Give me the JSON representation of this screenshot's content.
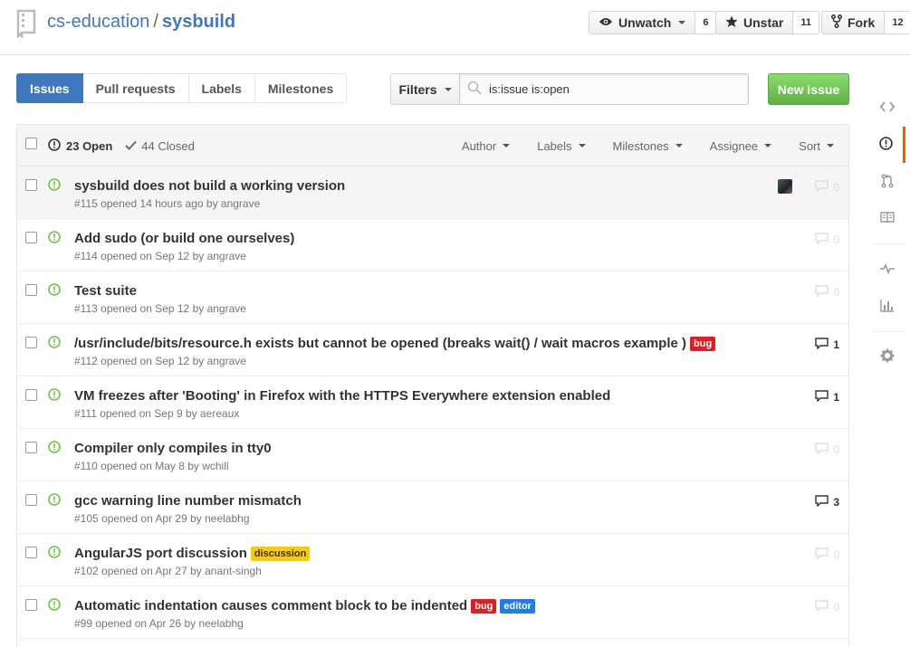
{
  "repo": {
    "owner": "cs-education",
    "separator": "/",
    "name": "sysbuild"
  },
  "actions": {
    "watch": {
      "label": "Unwatch",
      "count": "6"
    },
    "star": {
      "label": "Unstar",
      "count": "11"
    },
    "fork": {
      "label": "Fork",
      "count": "12"
    }
  },
  "subnav": {
    "issues": "Issues",
    "pulls": "Pull requests",
    "labels": "Labels",
    "milestones": "Milestones"
  },
  "filters": {
    "label": "Filters",
    "query": "is:issue is:open"
  },
  "new_issue": "New issue",
  "table_header": {
    "open": "23 Open",
    "closed": "44 Closed",
    "author": "Author",
    "labels": "Labels",
    "milestones": "Milestones",
    "assignee": "Assignee",
    "sort": "Sort"
  },
  "issues": [
    {
      "title": "sysbuild does not build a working version",
      "meta": "#115 opened 14 hours ago by angrave",
      "comments": "0"
    },
    {
      "title": "Add sudo (or build one ourselves)",
      "meta": "#114 opened on Sep 12 by angrave",
      "comments": "0"
    },
    {
      "title": "Test suite",
      "meta": "#113 opened on Sep 12 by angrave",
      "comments": "0"
    },
    {
      "title": "/usr/include/bits/resource.h exists but cannot be opened (breaks wait() / wait macros example )",
      "meta": "#112 opened on Sep 12 by angrave",
      "comments": "1",
      "label1": "bug"
    },
    {
      "title": "VM freezes after 'Booting' in Firefox with the HTTPS Everywhere extension enabled",
      "meta": "#111 opened on Sep 9 by aereaux",
      "comments": "1"
    },
    {
      "title": "Compiler only compiles in tty0",
      "meta": "#110 opened on May 8 by wchill",
      "comments": "0"
    },
    {
      "title": "gcc warning line number mismatch",
      "meta": "#105 opened on Apr 29 by neelabhg",
      "comments": "3"
    },
    {
      "title": "AngularJS port discussion",
      "meta": "#102 opened on Apr 27 by anant-singh",
      "comments": "0",
      "label1": "discussion"
    },
    {
      "title": "Automatic indentation causes comment block to be indented",
      "meta": "#99 opened on Apr 26 by neelabhg",
      "comments": "0",
      "label1": "bug",
      "label2": "editor"
    }
  ],
  "colors": {
    "accent": "#4078c0",
    "open_green": "#6cc644",
    "bug_label": "#e11d21",
    "discussion_label": "#fbca04",
    "editor_label": "#207de5",
    "new_issue_button": "#60b044",
    "sidenav_active": "#d26911"
  },
  "sidenav_icons": [
    "code-icon",
    "issue-opened-icon",
    "pull-request-icon",
    "book-icon",
    "pulse-icon",
    "graph-icon",
    "gear-icon"
  ]
}
